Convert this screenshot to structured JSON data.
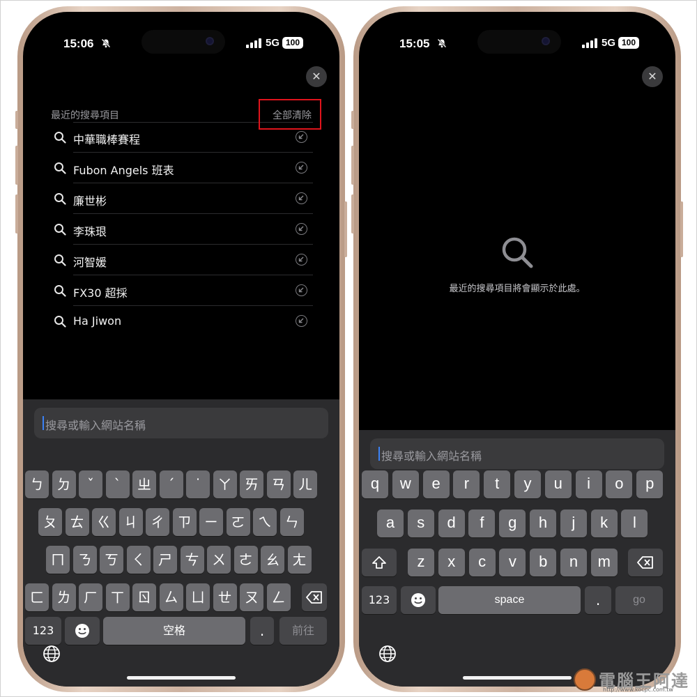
{
  "left_phone": {
    "status": {
      "time": "15:06",
      "network": "5G",
      "battery": "100"
    },
    "close_label": "✕",
    "recent_header": "最近的搜尋項目",
    "clear_all": "全部清除",
    "recent_items": [
      "中華職棒賽程",
      "Fubon Angels 班表",
      "廉世彬",
      "李珠珢",
      "河智媛",
      "FX30 超採",
      "Ha Jiwon"
    ],
    "address_placeholder": "搜尋或輸入網站名稱",
    "keyboard": {
      "row1": [
        "ㄅ",
        "ㄉ",
        "ˇ",
        "ˋ",
        "ㄓ",
        "ˊ",
        "˙",
        "ㄚ",
        "ㄞ",
        "ㄢ",
        "ㄦ"
      ],
      "row2": [
        "ㄆ",
        "ㄊ",
        "ㄍ",
        "ㄐ",
        "ㄔ",
        "ㄗ",
        "ㄧ",
        "ㄛ",
        "ㄟ",
        "ㄣ"
      ],
      "row3": [
        "ㄇ",
        "ㄋ",
        "ㄎ",
        "ㄑ",
        "ㄕ",
        "ㄘ",
        "ㄨ",
        "ㄜ",
        "ㄠ",
        "ㄤ"
      ],
      "row4": [
        "ㄈ",
        "ㄌ",
        "ㄏ",
        "ㄒ",
        "ㄖ",
        "ㄙ",
        "ㄩ",
        "ㄝ",
        "ㄡ",
        "ㄥ"
      ],
      "num_label": "123",
      "space_label": "空格",
      "dot_label": ".",
      "go_label": "前往"
    }
  },
  "right_phone": {
    "status": {
      "time": "15:05",
      "network": "5G",
      "battery": "100"
    },
    "close_label": "✕",
    "empty_message": "最近的搜尋項目將會顯示於此處。",
    "address_placeholder": "搜尋或輸入網站名稱",
    "keyboard": {
      "row1": [
        "q",
        "w",
        "e",
        "r",
        "t",
        "y",
        "u",
        "i",
        "o",
        "p"
      ],
      "row2": [
        "a",
        "s",
        "d",
        "f",
        "g",
        "h",
        "j",
        "k",
        "l"
      ],
      "row3": [
        "z",
        "x",
        "c",
        "v",
        "b",
        "n",
        "m"
      ],
      "num_label": "123",
      "space_label": "space",
      "dot_label": ".",
      "go_label": "go"
    }
  },
  "watermark": {
    "title": "電腦王阿達",
    "url": "http://www.kocpc.com.tw"
  },
  "colors": {
    "highlight": "#e0141c",
    "caret": "#3b82f6"
  }
}
